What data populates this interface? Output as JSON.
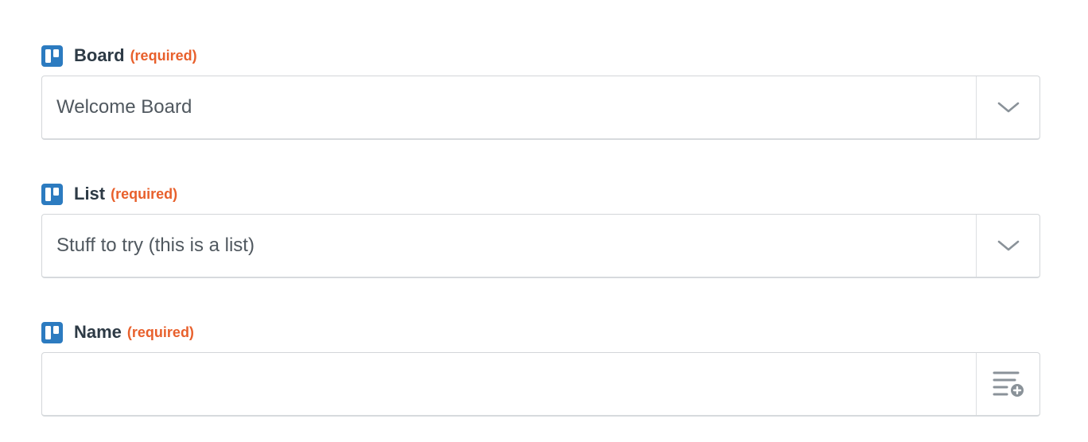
{
  "form": {
    "fields": [
      {
        "label": "Board",
        "required_text": "(required)",
        "value": "Welcome Board",
        "control": "dropdown",
        "icon": "trello-icon"
      },
      {
        "label": "List",
        "required_text": "(required)",
        "value": "Stuff to try (this is a list)",
        "control": "dropdown",
        "icon": "trello-icon"
      },
      {
        "label": "Name",
        "required_text": "(required)",
        "value": "",
        "control": "text",
        "icon": "trello-icon",
        "side_icon": "insert-data-icon"
      }
    ]
  },
  "colors": {
    "app_icon": "#2c7bc0",
    "required": "#e8602c",
    "label": "#2d3a45",
    "value": "#50585f",
    "border": "#d3d6d9"
  }
}
